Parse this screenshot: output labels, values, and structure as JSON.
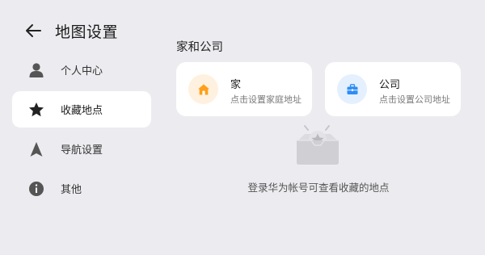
{
  "header": {
    "title": "地图设置"
  },
  "sidebar": {
    "items": [
      {
        "label": "个人中心",
        "icon": "person-icon",
        "active": false
      },
      {
        "label": "收藏地点",
        "icon": "star-icon",
        "active": true
      },
      {
        "label": "导航设置",
        "icon": "navigation-arrow-icon",
        "active": false
      },
      {
        "label": "其他",
        "icon": "info-icon",
        "active": false
      }
    ]
  },
  "main": {
    "section_title": "家和公司",
    "home": {
      "title": "家",
      "subtitle": "点击设置家庭地址",
      "icon": "home-icon",
      "color": "#ff9f1a"
    },
    "company": {
      "title": "公司",
      "subtitle": "点击设置公司地址",
      "icon": "briefcase-icon",
      "color": "#2f8df5"
    },
    "empty_message": "登录华为帐号可查看收藏的地点"
  }
}
